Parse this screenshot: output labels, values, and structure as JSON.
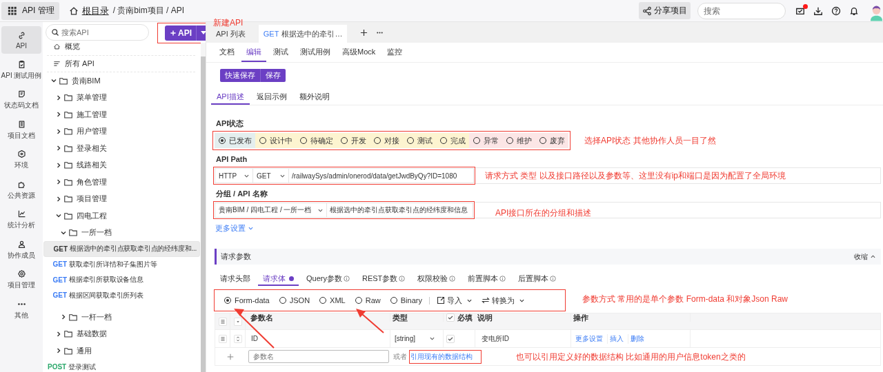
{
  "topbar": {
    "app_name": "API 管理",
    "breadcrumb_root": "根目录",
    "breadcrumb_path": "/ 贵南bim项目 / API",
    "share_label": "分享项目",
    "search_placeholder": "搜索",
    "task_alert": true
  },
  "rail": [
    {
      "label": "API",
      "selected": true
    },
    {
      "label": "API 测试用例",
      "selected": false
    },
    {
      "label": "状态码文档",
      "selected": false
    },
    {
      "label": "项目文档",
      "selected": false
    },
    {
      "label": "环境",
      "selected": false
    },
    {
      "label": "公共资源",
      "selected": false
    },
    {
      "label": "统计分析",
      "selected": false
    },
    {
      "label": "协作成员",
      "selected": false
    },
    {
      "label": "项目管理",
      "selected": false
    },
    {
      "label": "其他",
      "selected": false
    }
  ],
  "tree": {
    "search_placeholder": "搜索API",
    "new_button": "API",
    "items": [
      {
        "kind": "overview",
        "label": "概览"
      },
      {
        "kind": "all",
        "label": "所有 API"
      },
      {
        "kind": "folder",
        "label": "贵南BIM",
        "expanded": true,
        "children": [
          {
            "kind": "folder",
            "label": "菜单管理",
            "expanded": false
          },
          {
            "kind": "folder",
            "label": "施工管理",
            "expanded": false
          },
          {
            "kind": "folder",
            "label": "用户管理",
            "expanded": false
          },
          {
            "kind": "folder",
            "label": "登录相关",
            "expanded": false
          },
          {
            "kind": "folder",
            "label": "线路相关",
            "expanded": false
          },
          {
            "kind": "folder",
            "label": "角色管理",
            "expanded": false
          },
          {
            "kind": "folder",
            "label": "项目管理",
            "expanded": false
          },
          {
            "kind": "folder",
            "label": "四电工程",
            "expanded": true,
            "children": [
              {
                "kind": "folder",
                "label": "一所一档",
                "expanded": true,
                "children": [
                  {
                    "kind": "api",
                    "method": "GET",
                    "label": "根据选中的牵引点获取牵引点的经纬度和...",
                    "selected": true
                  },
                  {
                    "kind": "api",
                    "method": "GET",
                    "label": "获取牵引所详情和子集图片等",
                    "selected": false
                  },
                  {
                    "kind": "api",
                    "method": "GET",
                    "label": "根据牵引所获取设备信息",
                    "selected": false
                  },
                  {
                    "kind": "api",
                    "method": "GET",
                    "label": "根据区间获取牵引所列表",
                    "selected": false
                  }
                ]
              },
              {
                "kind": "folder",
                "label": "一杆一档",
                "expanded": false
              }
            ]
          },
          {
            "kind": "folder",
            "label": "基础数据",
            "expanded": false
          },
          {
            "kind": "folder",
            "label": "通用",
            "expanded": false
          }
        ]
      },
      {
        "kind": "api",
        "method": "POST",
        "label": "登录测试",
        "selected": false
      }
    ]
  },
  "tabs": [
    {
      "kind": "list",
      "label": "API 列表",
      "selected": false
    },
    {
      "kind": "api",
      "method": "GET",
      "label": "根据选中的牵引…",
      "selected": true
    }
  ],
  "sub_tabs": [
    {
      "label": "文档",
      "selected": false
    },
    {
      "label": "编辑",
      "selected": true
    },
    {
      "label": "测试",
      "selected": false
    },
    {
      "label": "测试用例",
      "selected": false
    },
    {
      "label": "高级Mock",
      "selected": false
    },
    {
      "label": "监控",
      "selected": false
    }
  ],
  "save_buttons": [
    "快速保存",
    "保存"
  ],
  "desc_tabs": [
    {
      "label": "API描述",
      "selected": true
    },
    {
      "label": "返回示例",
      "selected": false
    },
    {
      "label": "额外说明",
      "selected": false
    }
  ],
  "status": {
    "label": "API状态",
    "options": [
      {
        "label": "已发布",
        "color": "#e4eeee",
        "selected": true
      },
      {
        "label": "设计中",
        "color": "#fdf4d0",
        "selected": false
      },
      {
        "label": "待确定",
        "color": "#fdf4d0",
        "selected": false
      },
      {
        "label": "开发",
        "color": "#fdf4d0",
        "selected": false
      },
      {
        "label": "对接",
        "color": "#fdf4d0",
        "selected": false
      },
      {
        "label": "测试",
        "color": "#fdf4d0",
        "selected": false
      },
      {
        "label": "完成",
        "color": "#fdf4d0",
        "selected": false
      },
      {
        "label": "异常",
        "color": "#fce6e6",
        "selected": false
      },
      {
        "label": "维护",
        "color": "#fce6e6",
        "selected": false
      },
      {
        "label": "废弃",
        "color": "#fce6e6",
        "selected": false
      }
    ]
  },
  "path": {
    "label": "API Path",
    "protocol": "HTTP",
    "method": "GET",
    "value": "/railwaySys/admin/onerod/data/getJwdByQy?ID=1080"
  },
  "group": {
    "label": "分组 / API 名称",
    "group": "贵南BIM / 四电工程 / 一所一档",
    "name": "根据选中的牵引点获取牵引点的经纬度和信息"
  },
  "more_settings": "更多设置",
  "params": {
    "title": "请求参数",
    "collapse": "收缩",
    "tabs": [
      {
        "label": "请求头部",
        "selected": false,
        "info": false,
        "dot": false
      },
      {
        "label": "请求体",
        "selected": true,
        "info": false,
        "dot": true
      },
      {
        "label": "Query参数",
        "selected": false,
        "info": true,
        "dot": false
      },
      {
        "label": "REST参数",
        "selected": false,
        "info": true,
        "dot": false
      },
      {
        "label": "权限校验",
        "selected": false,
        "info": true,
        "dot": false
      },
      {
        "label": "前置脚本",
        "selected": false,
        "info": true,
        "dot": false
      },
      {
        "label": "后置脚本",
        "selected": false,
        "info": true,
        "dot": false
      }
    ],
    "body_types": [
      {
        "label": "Form-data",
        "selected": true
      },
      {
        "label": "JSON",
        "selected": false
      },
      {
        "label": "XML",
        "selected": false
      },
      {
        "label": "Raw",
        "selected": false
      },
      {
        "label": "Binary",
        "selected": false
      }
    ],
    "import": "导入",
    "convert": "转换为",
    "columns": [
      "参数名",
      "类型",
      "必填",
      "说明",
      "操作"
    ],
    "required_all_checked": true,
    "rows": [
      {
        "name": "ID",
        "type": "[string]",
        "required": true,
        "description": "变电所ID",
        "actions": [
          "更多设置",
          "插入",
          "删除"
        ]
      }
    ],
    "new_row": {
      "placeholder": "参数名",
      "or": "或者",
      "link": "引用现有的数据结构"
    }
  },
  "annotations": [
    {
      "kind": "note",
      "text": "新建API"
    },
    {
      "kind": "note",
      "text": "选择API状态  其他协作人员一目了然"
    },
    {
      "kind": "note",
      "text": "请求方式 类型 以及接口路径以及参数等、这里没有ip和端口是因为配置了全局环境"
    },
    {
      "kind": "note",
      "text": "API接口所在的分组和描述"
    },
    {
      "kind": "note-arrows",
      "text": "参数方式  常用的是单个参数 Form-data 和对象Json Raw"
    },
    {
      "kind": "note",
      "text": "也可以引用定义好的数据结构  比如通用的用户信息token之类的"
    }
  ]
}
